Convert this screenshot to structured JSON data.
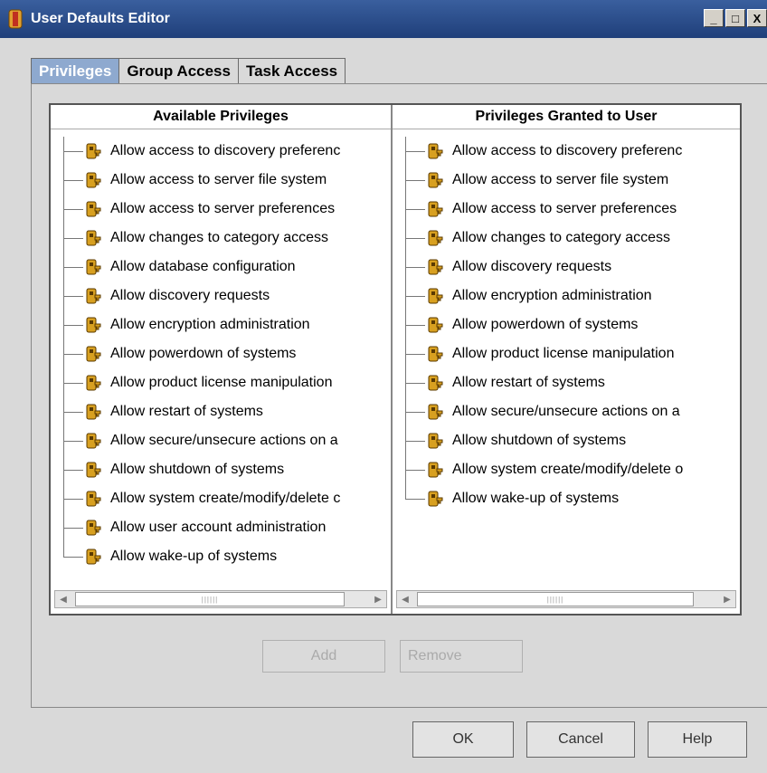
{
  "window": {
    "title": "User Defaults Editor",
    "controls": [
      "_",
      "□",
      "X"
    ]
  },
  "tabs": [
    {
      "label": "Privileges",
      "active": true
    },
    {
      "label": "Group Access",
      "active": false
    },
    {
      "label": "Task Access",
      "active": false
    }
  ],
  "available": {
    "header": "Available Privileges",
    "items": [
      "Allow access to discovery preferenc",
      "Allow access to server file system",
      "Allow access to server preferences",
      "Allow changes to category access",
      "Allow database configuration",
      "Allow discovery requests",
      "Allow encryption administration",
      "Allow powerdown of systems",
      "Allow product license manipulation",
      "Allow restart of systems",
      "Allow secure/unsecure actions on a",
      "Allow shutdown of systems",
      "Allow system create/modify/delete c",
      "Allow user account administration",
      "Allow wake-up of systems"
    ]
  },
  "granted": {
    "header": "Privileges Granted to User",
    "items": [
      "Allow access to discovery preferenc",
      "Allow access to server file system",
      "Allow access to server preferences",
      "Allow changes to category access",
      "Allow discovery requests",
      "Allow encryption administration",
      "Allow powerdown of systems",
      "Allow product license manipulation",
      "Allow restart of systems",
      "Allow secure/unsecure actions on a",
      "Allow shutdown of systems",
      "Allow system create/modify/delete o",
      "Allow wake-up of systems"
    ]
  },
  "actions": {
    "add": "Add",
    "remove": "Remove"
  },
  "footer": {
    "ok": "OK",
    "cancel": "Cancel",
    "help": "Help"
  }
}
